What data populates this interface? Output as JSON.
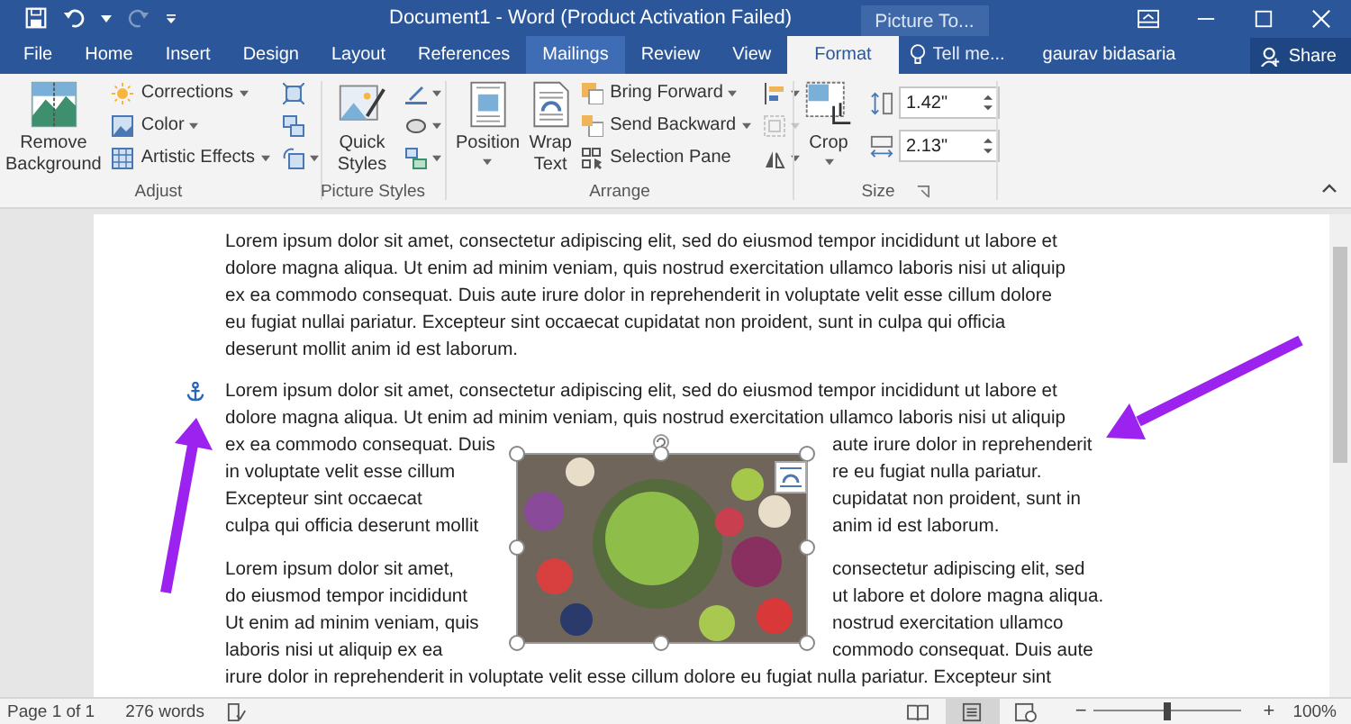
{
  "title_bar": {
    "title": "Document1 - Word (Product Activation Failed)",
    "contextual_tab": "Picture To...",
    "redo_disabled": true
  },
  "tabs": [
    {
      "label": "File",
      "selected": false,
      "hovered": false
    },
    {
      "label": "Home",
      "selected": false,
      "hovered": false
    },
    {
      "label": "Insert",
      "selected": false,
      "hovered": false
    },
    {
      "label": "Design",
      "selected": false,
      "hovered": false
    },
    {
      "label": "Layout",
      "selected": false,
      "hovered": false
    },
    {
      "label": "References",
      "selected": false,
      "hovered": false
    },
    {
      "label": "Mailings",
      "selected": false,
      "hovered": true
    },
    {
      "label": "Review",
      "selected": false,
      "hovered": false
    },
    {
      "label": "View",
      "selected": false,
      "hovered": false
    },
    {
      "label": "Format",
      "selected": true,
      "hovered": false
    }
  ],
  "tell_me": {
    "placeholder": "Tell me..."
  },
  "user": "gaurav bidasaria",
  "share_button": "Share",
  "ribbon": {
    "adjust": {
      "label": "Adjust",
      "remove_background": "Remove Background",
      "corrections": "Corrections",
      "color_button": "Color",
      "artistic_effects": "Artistic Effects"
    },
    "picture_styles": {
      "label": "Picture Styles",
      "quick_styles": "Quick Styles"
    },
    "arrange": {
      "label": "Arrange",
      "position": "Position",
      "wrap_text": "Wrap Text",
      "bring_forward": "Bring Forward",
      "send_backward": "Send Backward",
      "selection_pane": "Selection Pane"
    },
    "size": {
      "label": "Size",
      "crop": "Crop",
      "height": "1.42\"",
      "width": "2.13\""
    }
  },
  "document": {
    "paragraph_1": [
      "Lorem ipsum dolor sit amet, consectetur adipiscing elit, sed do eiusmod tempor incididunt ut labore et",
      "dolore magna aliqua. Ut enim ad minim veniam, quis nostrud exercitation ullamco laboris nisi ut aliquip",
      "ex ea commodo consequat. Duis aute irure dolor in reprehenderit in voluptate velit esse cillum dolore",
      "eu fugiat nullai pariatur. Excepteur sint occaecat cupidatat non proident, sunt in culpa qui officia",
      "deserunt mollit anim id est laborum."
    ],
    "paragraph_2_full": [
      "Lorem ipsum dolor sit amet, consectetur adipiscing elit, sed do eiusmod tempor incididunt ut labore et",
      "dolore magna aliqua. Ut enim ad minim veniam, quis nostrud exercitation ullamco laboris nisi ut aliquip"
    ],
    "paragraph_2_left": [
      "ex ea commodo consequat. Duis",
      "in voluptate velit esse cillum",
      "Excepteur sint occaecat",
      "culpa qui officia deserunt mollit"
    ],
    "paragraph_2_right": [
      "aute irure dolor in reprehenderit",
      "re eu fugiat nulla pariatur.",
      "cupidatat non proident, sunt in",
      "anim id est laborum."
    ],
    "paragraph_3_left": [
      "Lorem ipsum dolor sit amet,",
      "do eiusmod tempor incididunt",
      "Ut enim ad minim veniam, quis",
      "laboris nisi ut aliquip ex ea"
    ],
    "paragraph_3_right": [
      "consectetur adipiscing elit, sed",
      "ut labore et dolore magna aliqua.",
      "nostrud exercitation ullamco",
      "commodo consequat. Duis aute"
    ],
    "paragraph_3_full": [
      "irure dolor in reprehenderit in voluptate velit esse cillum dolore eu fugiat nulla pariatur. Excepteur sint"
    ]
  },
  "status_bar": {
    "page": "Page 1 of 1",
    "words": "276 words",
    "views": [
      {
        "kind": "read",
        "selected": false
      },
      {
        "kind": "print",
        "selected": true
      },
      {
        "kind": "web",
        "selected": false
      }
    ],
    "zoom": {
      "zoom_out": "−",
      "level": 0.5,
      "zoom_in": "+",
      "reading": "100%"
    }
  }
}
